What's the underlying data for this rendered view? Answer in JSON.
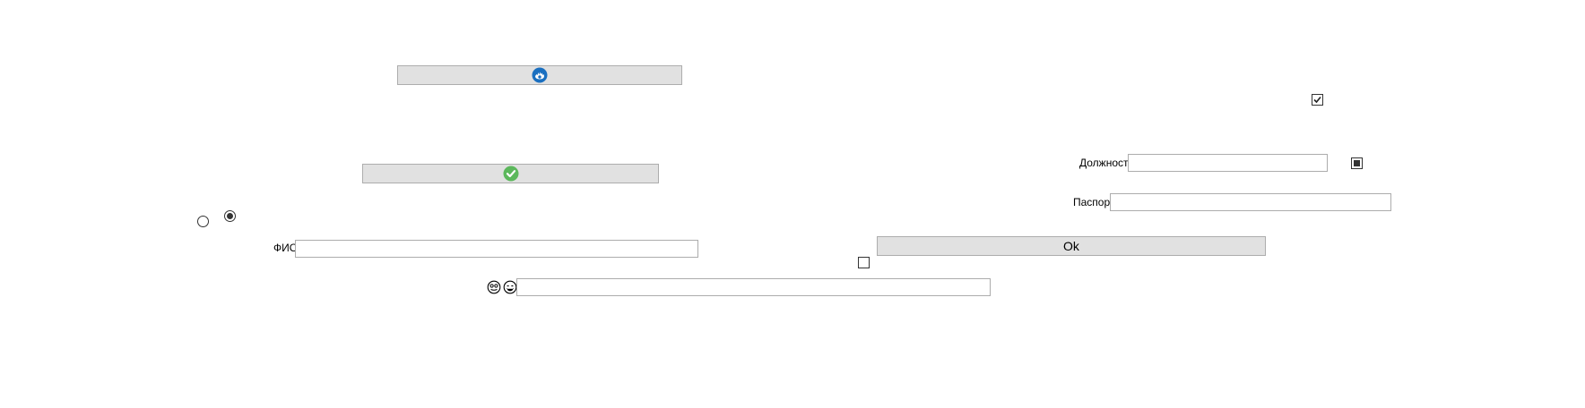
{
  "buttons": {
    "ok_label": "Ok"
  },
  "labels": {
    "fio": "ФИО",
    "position": "Должность",
    "passport": "Паспорт"
  },
  "fields": {
    "fio_value": "",
    "position_value": "",
    "passport_value": "",
    "emoji_value": ""
  },
  "checkboxes": {
    "top_right_checked": true,
    "mid_right_state": "indeterminate",
    "ok_below_checked": false
  },
  "radios": {
    "left_selected": false,
    "right_selected": true
  },
  "icons": {
    "top_button_icon": "blue-circle-logo-icon",
    "second_button_icon": "green-check-circle-icon",
    "emoji_1": "neutral-face-icon",
    "emoji_2": "grinning-face-icon"
  },
  "colors": {
    "button_bg": "#e1e1e1",
    "button_border": "#adadad",
    "field_border": "#acacac",
    "logo_blue": "#1a6fc0",
    "check_green": "#5cb85c"
  }
}
